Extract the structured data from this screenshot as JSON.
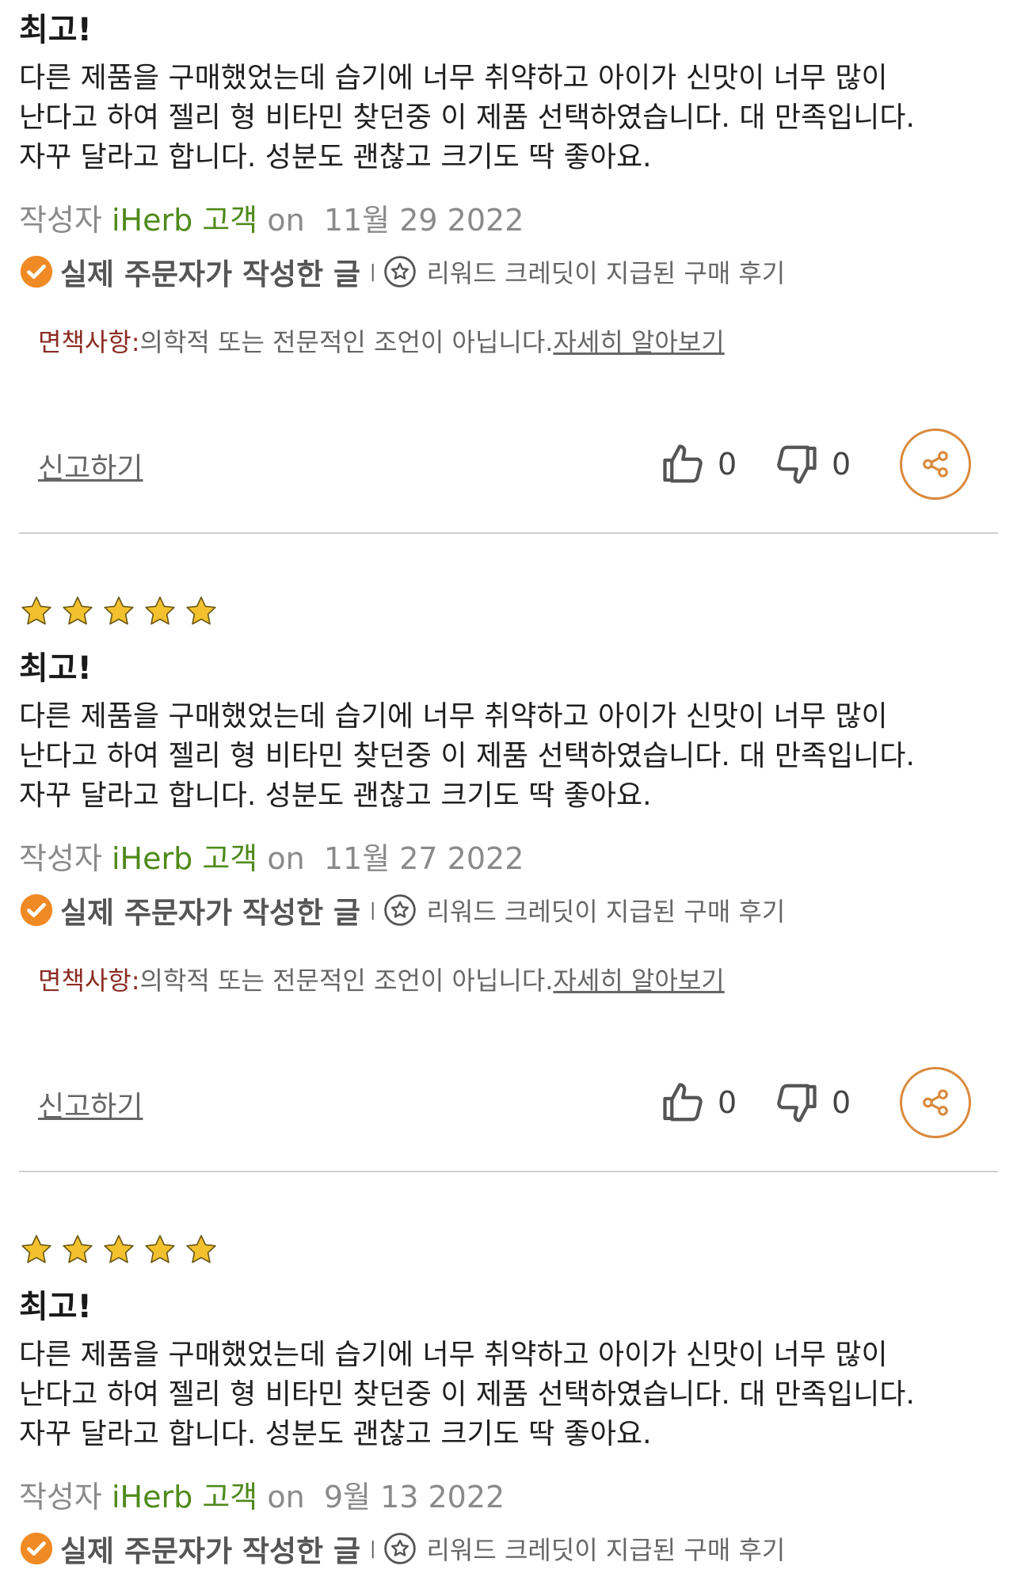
{
  "colors": {
    "author": "#4f8a1b",
    "disclaimer_label": "#8b2d24",
    "star": "#f3c12d",
    "verified_check": "#f08a24",
    "share_border": "#d98a3d"
  },
  "common": {
    "title": "최고!",
    "body_lines": [
      "다른 제품을 구매했었는데 습기에 너무 취약하고 아이가 신맛이 너무 많이",
      "난다고 하여 젤리 형 비타민 찾던중 이 제품 선택하였습니다. 대 만족입니다.",
      "자꾸 달라고 합니다. 성분도 괜찮고 크기도 딱 좋아요."
    ],
    "author_prefix": "작성자",
    "author_name": "iHerb 고객",
    "on_label": "on",
    "verified_label": "실제 주문자가 작성한 글",
    "separator": "|",
    "reward_label": "리워드 크레딧이 지급된 구매 후기",
    "disclaimer_label": "면책사항:",
    "disclaimer_text": "의학적 또는 전문적인 조언이 아닙니다.",
    "learn_more": "자세히 알아보기",
    "report_label": "신고하기",
    "rating": 5,
    "icons": {
      "star": "star-icon",
      "verified": "check-circle-icon",
      "reward": "reward-star-icon",
      "helpful": "thumbs-up-icon",
      "not_helpful": "thumbs-down-icon",
      "share": "share-icon"
    }
  },
  "reviews": [
    {
      "date": "11월 29 2022",
      "helpful_count": "0",
      "not_helpful_count": "0"
    },
    {
      "date": "11월 27 2022",
      "helpful_count": "0",
      "not_helpful_count": "0"
    },
    {
      "date": "9월 13 2022"
    }
  ]
}
